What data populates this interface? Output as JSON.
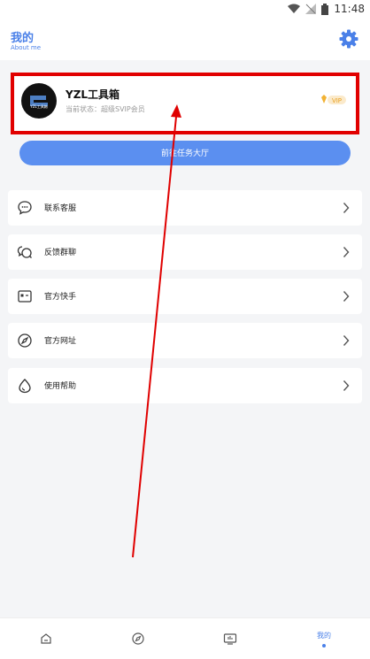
{
  "status_bar": {
    "time": "11:48"
  },
  "header": {
    "title": "我的",
    "subtitle": "About me"
  },
  "profile": {
    "name": "YZL工具箱",
    "status": "当前状态：超级SVIP会员",
    "avatar_text": "YZL工具箱",
    "badge": "VIP"
  },
  "task_button": {
    "label": "前往任务大厅"
  },
  "menu": {
    "items": [
      {
        "label": "联系客服",
        "icon": "chat-bubble-icon"
      },
      {
        "label": "反馈群聊",
        "icon": "group-chat-icon"
      },
      {
        "label": "官方快手",
        "icon": "video-icon"
      },
      {
        "label": "官方网址",
        "icon": "compass-icon"
      },
      {
        "label": "使用帮助",
        "icon": "help-drop-icon"
      }
    ]
  },
  "tabbar": {
    "tabs": [
      {
        "icon": "home-icon",
        "label": ""
      },
      {
        "icon": "compass-icon",
        "label": ""
      },
      {
        "icon": "tv-icon",
        "label": ""
      },
      {
        "icon": "profile-icon",
        "label": "我的",
        "active": true
      }
    ]
  },
  "colors": {
    "accent": "#4a80e8",
    "button": "#5b8ff0",
    "highlight_border": "#e10000",
    "annotation_arrow": "#e00000"
  }
}
